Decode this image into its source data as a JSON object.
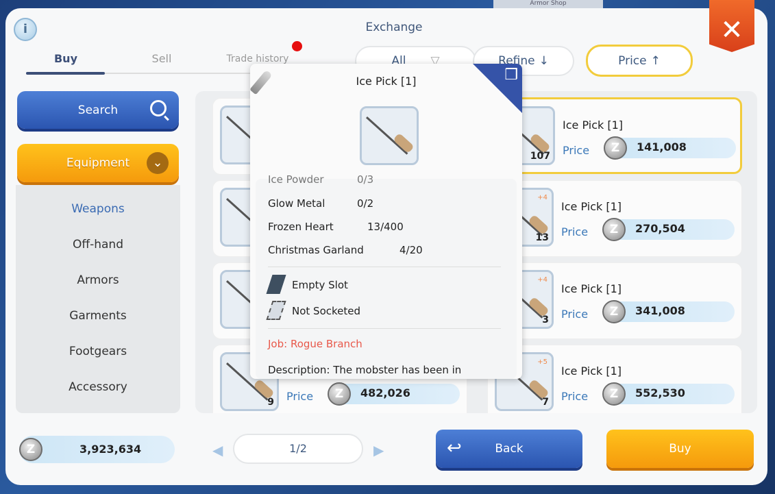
{
  "background": {
    "shop_label": "Armor Shop"
  },
  "header": {
    "title": "Exchange",
    "info_icon": "info-icon",
    "close_icon": "close-icon"
  },
  "tabs": [
    {
      "label": "Buy",
      "active": true
    },
    {
      "label": "Sell"
    },
    {
      "label": "Trade history",
      "notification": true
    }
  ],
  "filters": {
    "all": "All",
    "refine": "Refine",
    "refine_arrow": "↓",
    "price": "Price",
    "price_arrow": "↑"
  },
  "sidebar": {
    "search_label": "Search",
    "category_label": "Equipment",
    "items": [
      "Weapons",
      "Off-hand",
      "Armors",
      "Garments",
      "Footgears",
      "Accessory"
    ],
    "active": "Weapons"
  },
  "listings": [
    {
      "name": "Ice Pick [1]",
      "price_label": "Price",
      "price": "141,008",
      "count": "107",
      "refine": "",
      "selected": true
    },
    {
      "name": "Ice Pick [1]",
      "price_label": "Price",
      "price": "270,504",
      "count": "13",
      "refine": "+4"
    },
    {
      "name": "Ice Pick [1]",
      "price_label": "Price",
      "price": "341,008",
      "count": "3",
      "refine": "+4"
    },
    {
      "name": "Ice Pick [1]",
      "price_label": "Price",
      "price": "552,530",
      "count": "7",
      "refine": "+5"
    },
    {
      "name": "",
      "price_label": "Price",
      "price": "482,026",
      "count": "9",
      "refine": ""
    }
  ],
  "tooltip": {
    "title": "Ice Pick [1]",
    "materials": [
      {
        "name": "Ice Powder",
        "value": "0/3"
      },
      {
        "name": "Glow Metal",
        "value": "0/2"
      },
      {
        "name": "Frozen Heart",
        "value": "13/400"
      },
      {
        "name": "Christmas Garland",
        "value": "4/20"
      }
    ],
    "slots": [
      "Empty Slot",
      "Not Socketed"
    ],
    "job": "Job: Rogue  Branch",
    "description": "Description: The mobster has been in",
    "job_color": "#e8584a"
  },
  "footer": {
    "zeny": "3,923,634",
    "page": "1/2",
    "back_label": "Back",
    "buy_label": "Buy"
  },
  "colors": {
    "accent_blue": "#2b55b0",
    "accent_orange": "#f59a0c",
    "selected_border": "#f2cc3c",
    "close_red": "#d8401a"
  }
}
